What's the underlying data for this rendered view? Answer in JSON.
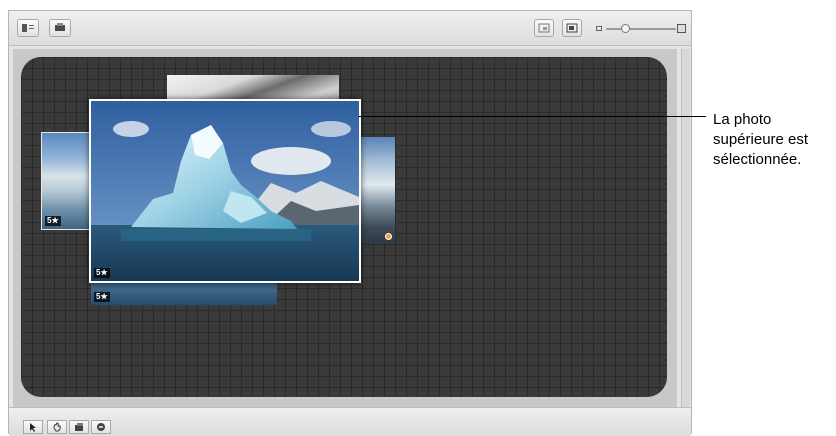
{
  "toolbar": {
    "left_buttons": [
      "flag-icon",
      "light-table-icon"
    ],
    "right_buttons": [
      "zoom-fit-icon",
      "zoom-actual-icon"
    ],
    "zoom_slider": {
      "level": 0.25
    }
  },
  "photos": {
    "main": {
      "rating": "5★",
      "selected": true
    },
    "left": {
      "rating": "5★"
    },
    "bottom": {
      "rating": "5★"
    },
    "right": {
      "badge_color": "#f0a030"
    }
  },
  "bottom_tools": [
    "pointer-icon",
    "hand-icon",
    "stack-icon",
    "eraser-icon"
  ],
  "callout": {
    "line1": "La photo",
    "line2": "supérieure est",
    "line3": "sélectionnée."
  },
  "colors": {
    "canvas_dark": "#3a3a3a",
    "selection_border": "#ffffff"
  }
}
